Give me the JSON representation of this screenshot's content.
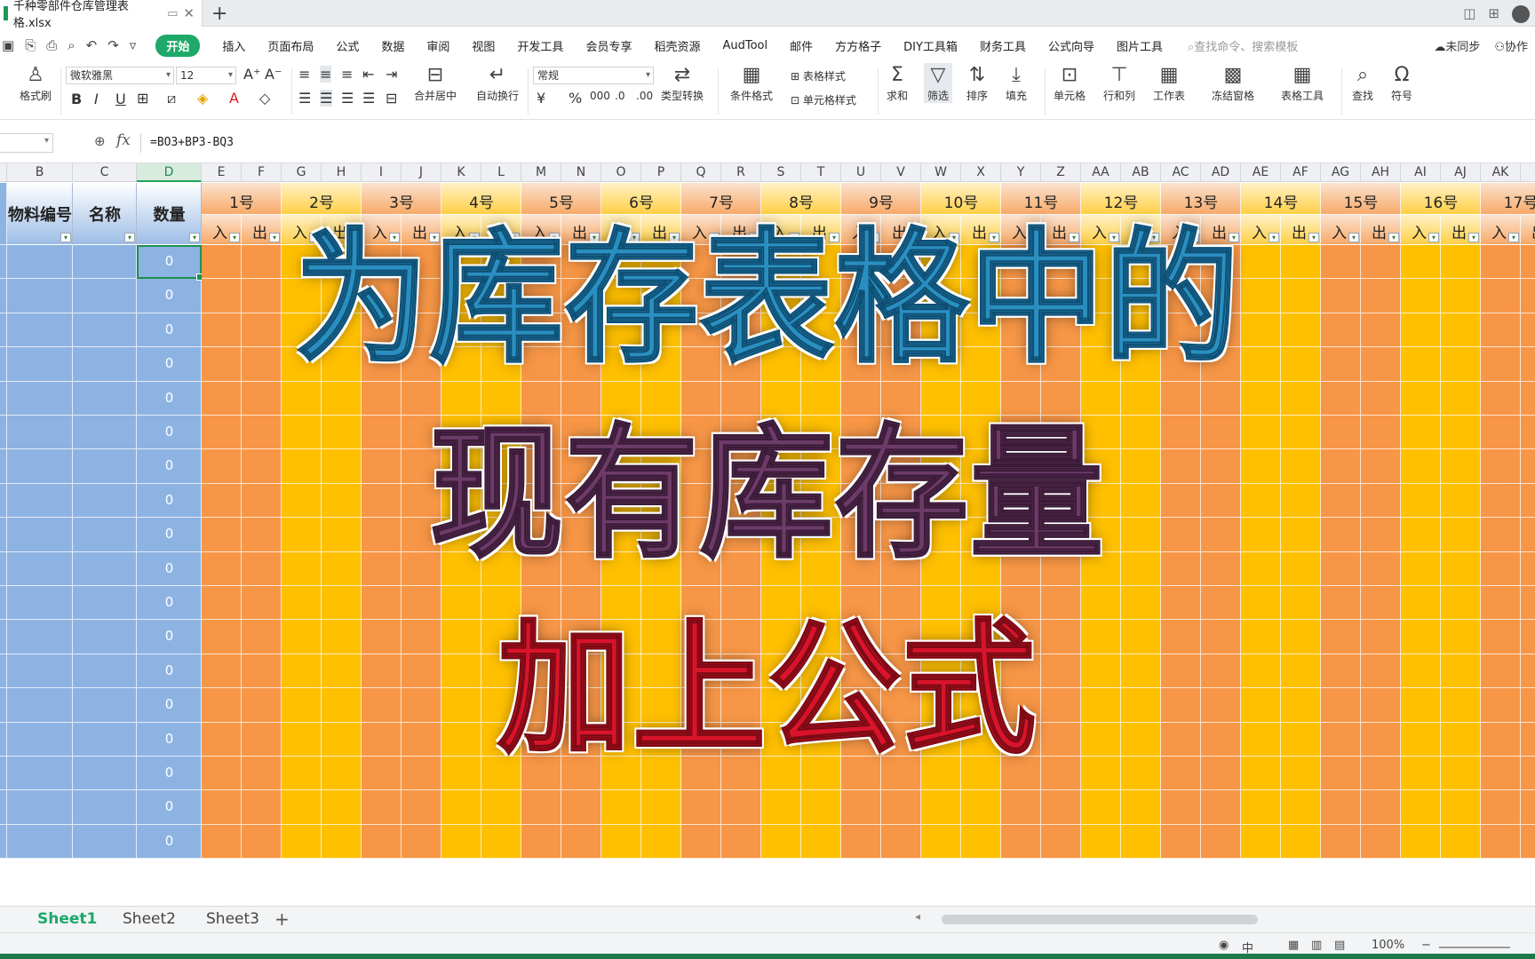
{
  "window": {
    "file_tab": "千种零部件仓库管理表格.xlsx",
    "new_tab_label": "+"
  },
  "menu": {
    "active": "开始",
    "items": [
      "插入",
      "页面布局",
      "公式",
      "数据",
      "审阅",
      "视图",
      "开发工具",
      "会员专享",
      "稻壳资源",
      "AudTool",
      "邮件",
      "方方格子",
      "DIY工具箱",
      "财务工具",
      "公式向导",
      "图片工具"
    ],
    "search_placeholder": "查找命令、搜索模板",
    "sync": "未同步",
    "collab": "协作"
  },
  "ribbon": {
    "format_painter": "格式刷",
    "font_name": "微软雅黑",
    "font_size": "12",
    "merge_center": "合并居中",
    "wrap_text": "自动换行",
    "number_format": "常规",
    "type_convert": "类型转换",
    "cond_format": "条件格式",
    "table_style": "表格样式",
    "cell_style": "单元格样式",
    "sum": "求和",
    "filter": "筛选",
    "sort": "排序",
    "fill": "填充",
    "cells": "单元格",
    "row_col": "行和列",
    "worksheet": "工作表",
    "freeze": "冻结窗格",
    "table_tools": "表格工具",
    "find": "查找",
    "symbol": "符号"
  },
  "formula_bar": {
    "fx": "fx",
    "formula": "=BO3+BP3-BQ3"
  },
  "columns": [
    "B",
    "C",
    "D",
    "E",
    "F",
    "G",
    "H",
    "I",
    "J",
    "K",
    "L",
    "M",
    "N",
    "O",
    "P",
    "Q",
    "R",
    "S",
    "T",
    "U",
    "V",
    "W",
    "X",
    "Y",
    "Z",
    "AA",
    "AB",
    "AC",
    "AD",
    "AE",
    "AF",
    "AG",
    "AH",
    "AI",
    "AJ",
    "AK"
  ],
  "selected_column": "D",
  "headers": {
    "material_code": "物料编号",
    "name": "名称",
    "quantity": "数量"
  },
  "days": [
    "1号",
    "2号",
    "3号",
    "4号",
    "5号",
    "6号",
    "7号",
    "8号",
    "9号",
    "10号",
    "11号",
    "12号",
    "13号",
    "14号",
    "15号",
    "16号",
    "17号"
  ],
  "io_labels": {
    "in": "入",
    "out": "出"
  },
  "quantity_values": [
    "0",
    "0",
    "0",
    "0",
    "0",
    "0",
    "0",
    "0",
    "0",
    "0",
    "0",
    "0",
    "0",
    "0",
    "0",
    "0",
    "0",
    "0"
  ],
  "overlay": {
    "line1": "为库存表格中的",
    "line2": "现有库存量",
    "line3": "加上公式"
  },
  "sheets": [
    "Sheet1",
    "Sheet2",
    "Sheet3"
  ],
  "active_sheet": "Sheet1",
  "status": {
    "zoom": "100%",
    "input_mode": "中"
  },
  "colors": {
    "blue_cols": "#8db3e2",
    "orange_day": "#f79646",
    "yellow_day": "#ffc000",
    "accent_green": "#1ea86a"
  }
}
